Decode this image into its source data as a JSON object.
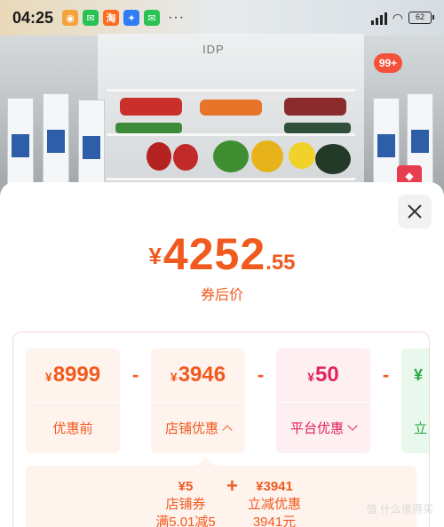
{
  "status_bar": {
    "time": "04:25",
    "battery": "62",
    "apps": [
      {
        "name": "weibo-icon",
        "color": "#f4a23a",
        "glyph": "◉"
      },
      {
        "name": "wechat-icon",
        "color": "#2bc255",
        "glyph": "✉"
      },
      {
        "name": "taobao-icon",
        "color": "#ff6a1f",
        "glyph": "淘"
      },
      {
        "name": "pin-icon",
        "color": "#2f7cf6",
        "glyph": "✦"
      },
      {
        "name": "wechat-icon-2",
        "color": "#2bc255",
        "glyph": "✉"
      }
    ],
    "more": "···"
  },
  "background": {
    "brand_text": "IDP",
    "cart_badge": "99+"
  },
  "sheet": {
    "final_price": {
      "currency": "¥",
      "integer": "4252",
      "decimal": ".55"
    },
    "final_label": "券后价",
    "cards": [
      {
        "amount": "8999",
        "label": "优惠前"
      },
      {
        "amount": "3946",
        "label": "店铺优惠"
      },
      {
        "amount": "50",
        "label": "平台优惠"
      },
      {
        "amount": "¥",
        "label": "立"
      }
    ],
    "currency": "¥",
    "minus": "-",
    "details": {
      "coupon": {
        "amount": "¥5",
        "name": "店铺券",
        "desc": "满5.01减5"
      },
      "plus": "+",
      "instant": {
        "amount": "¥3941",
        "name": "立减优惠",
        "desc": "3941元"
      }
    },
    "watermark": "值 什么值得买"
  },
  "colors": {
    "accent": "#f05a1e",
    "platform": "#e0245e",
    "card_bg": "#fff3ee"
  }
}
